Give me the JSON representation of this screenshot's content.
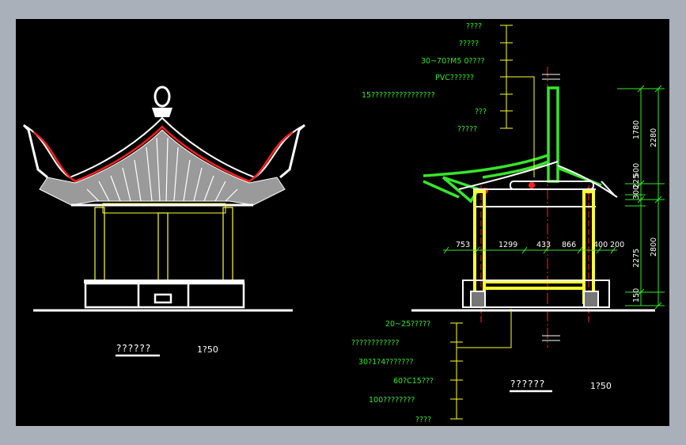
{
  "drawing": {
    "left_title": "??????",
    "left_scale": "1?50",
    "right_title": "??????",
    "right_scale": "1?50"
  },
  "notes_top": [
    "????",
    "?????",
    "30~70?M5 0????",
    "PVC??????",
    "15????????????????",
    "???",
    "?????"
  ],
  "notes_bottom": [
    "20~25?????",
    "????????????",
    "30?1?4???????",
    "60?C15???",
    "100????????",
    "????"
  ],
  "dims_horizontal": [
    "753",
    "1299",
    "433",
    "866",
    "400",
    "200"
  ],
  "dims_vertical_inner": [
    "1780",
    "300",
    "225",
    "500",
    "2275",
    "150"
  ],
  "dims_vertical_outer": [
    "2280",
    "2800"
  ],
  "colors": {
    "green": "#37e62b",
    "yellow": "#ffff33",
    "red": "#ff2222",
    "white": "#ffffff",
    "background": "#000000"
  }
}
